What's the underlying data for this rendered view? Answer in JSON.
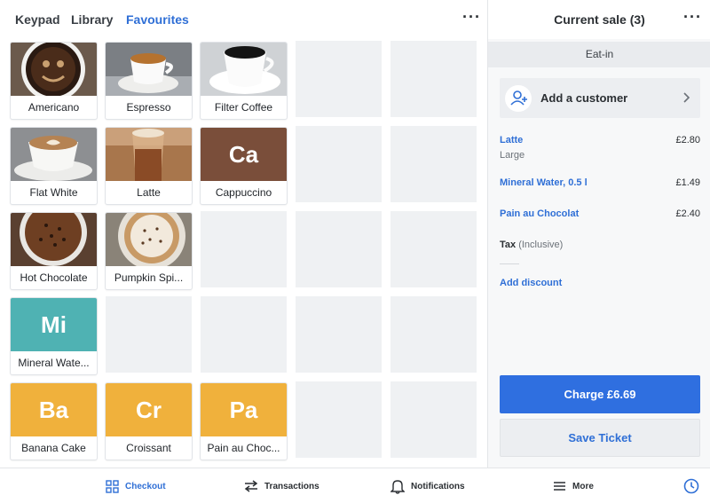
{
  "tabs": {
    "keypad": "Keypad",
    "library": "Library",
    "favourites": "Favourites"
  },
  "more_glyph": "···",
  "tiles": {
    "americano": "Americano",
    "espresso": "Espresso",
    "filter_coffee": "Filter Coffee",
    "flat_white": "Flat White",
    "latte": "Latte",
    "cappuccino": {
      "label": "Cappuccino",
      "abbr": "Ca",
      "color": "#7a4e3a"
    },
    "hot_chocolate": "Hot Chocolate",
    "pumpkin_spice": "Pumpkin Spi...",
    "mineral_water": {
      "label": "Mineral Wate...",
      "abbr": "Mi",
      "color": "#4fb2b3"
    },
    "banana_cake": {
      "label": "Banana Cake",
      "abbr": "Ba",
      "color": "#f0b13c"
    },
    "croissant": {
      "label": "Croissant",
      "abbr": "Cr",
      "color": "#f0b13c"
    },
    "pain_au_chocolat": {
      "label": "Pain au Choc...",
      "abbr": "Pa",
      "color": "#f0b13c"
    }
  },
  "sale": {
    "title": "Current sale (3)",
    "eat_in": "Eat-in",
    "add_customer": "Add a customer",
    "items": [
      {
        "name": "Latte",
        "price": "£2.80",
        "variant": "Large"
      },
      {
        "name": "Mineral Water, 0.5 l",
        "price": "£1.49"
      },
      {
        "name": "Pain au Chocolat",
        "price": "£2.40"
      }
    ],
    "tax_label": "Tax",
    "tax_note": "(Inclusive)",
    "add_discount": "Add discount",
    "charge": "Charge £6.69",
    "save_ticket": "Save Ticket"
  },
  "bottom_nav": {
    "checkout": "Checkout",
    "transactions": "Transactions",
    "notifications": "Notifications",
    "more": "More"
  },
  "colors": {
    "accent": "#2f6fd6",
    "charge_button": "#2f6fe0",
    "empty_cell": "#eff1f3"
  },
  "icons": [
    "ellipsis-icon",
    "add-person-icon",
    "chevron-right-icon",
    "grid-icon",
    "arrows-swap-icon",
    "bell-icon",
    "menu-icon",
    "clock-icon"
  ]
}
